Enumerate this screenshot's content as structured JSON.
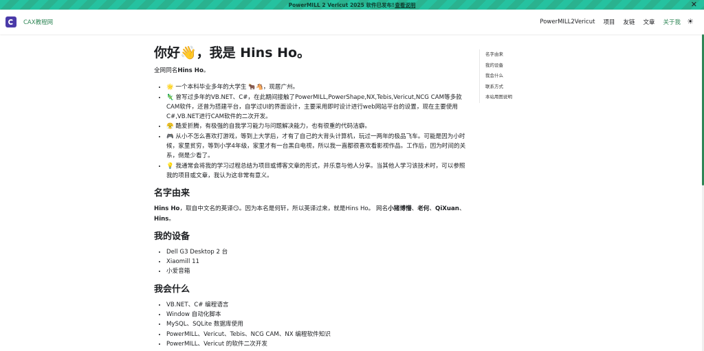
{
  "announcement": {
    "text": "PowerMILL 2 Vericut 2025 软件已发布! ",
    "link": "查看说明",
    "close_glyph": "✕"
  },
  "navbar": {
    "brand": "CAX教程网",
    "items": [
      {
        "label": "PowerMILL2Vericut"
      },
      {
        "label": "项目"
      },
      {
        "label": "友链"
      },
      {
        "label": "文章"
      },
      {
        "label": "关于我"
      }
    ],
    "active_item": "关于我",
    "theme_icon": "sun-icon",
    "accent_color": "#2e8555",
    "logo_color": "#4a3aa8"
  },
  "article": {
    "title": "你好👋，我是 Hins Ho。",
    "subtitle_prefix": "全网同名",
    "subtitle_name": "Hins Ho",
    "subtitle_suffix": "。",
    "intro": [
      "🌟 一个本科毕业多年的大学生 🐂🐴，现居广州。",
      "🦎 曾写过多年的VB.NET、C#，在此期间接触了PowerMILL,PowerShape,NX,Tebis,Vericut,NCG CAM等多款CAM软件，还曾为搭建平台，自学过UI的界面设计，主要采用即时设计进行web网站平台的设置，现在主要使用C#,VB.NET进行CAM软件的二次开发。",
      "😤 酷爱折腾，有极强的自我学习能力与问题解决能力，也有很重的代码洁癖。",
      "🎮 从小不怎么喜欢打游戏，等到上大学后，才有了自己的大背头计算机，玩过一两年的极品飞车。可能是因为小时候，家里贫穷，等到小学4年级，家里才有一台黑白电视，所以我一直都很喜欢看影视作品。工作后，因为时间的关系，倒是少看了。",
      "💡 我通常会将我的学习过程总结为项目或博客文章的形式，并乐意与他人分享。当其他人学习该技术时，可以参照我的项目或文章，我认为这非常有意义。"
    ],
    "sections": {
      "name_title": "名字由来",
      "name_text_1": "Hins Ho",
      "name_text_2": "，取自中文名的英译😏。因为本名是何轩，所以英译过来，就是Hins Ho。 网名",
      "name_text_3": "小猪博懵",
      "name_text_4": "、",
      "name_text_5": "老何",
      "name_text_6": "、",
      "name_text_7": "QiXuan",
      "name_text_8": "、",
      "name_text_9": "Hins",
      "name_text_10": "。",
      "devices_title": "我的设备",
      "devices": [
        "Dell G3 Desktop 2 台",
        "Xiaomill 11",
        "小爱音箱"
      ],
      "skills_title": "我会什么",
      "skills": [
        "VB.NET、C# 编程语言",
        "Window 自动化脚本",
        "MySQL、SQLite 数据库使用",
        "PowerMILL、Vericut、Tebis、NCG CAM、NX 编程软件知识",
        "PowerMILL、Vericut 的软件二次开发"
      ]
    }
  },
  "toc": {
    "items": [
      "名字由来",
      "我的设备",
      "我会什么",
      "联系方式",
      "本站用图说明"
    ]
  }
}
